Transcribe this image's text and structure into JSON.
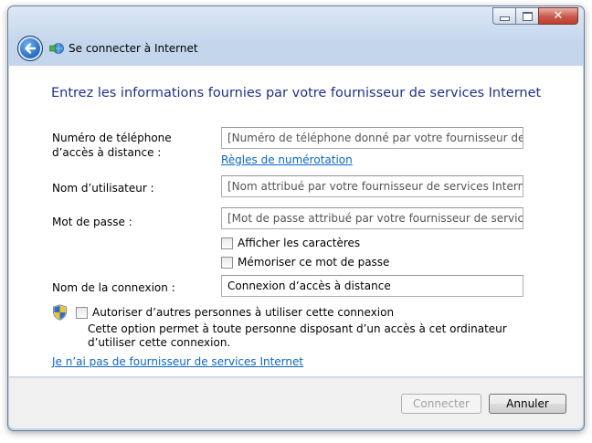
{
  "window": {
    "title": "Se connecter à Internet",
    "controls": {
      "minimize": "minimize-icon",
      "maximize": "maximize-icon",
      "close": "close-icon"
    },
    "back_icon": "back-arrow-icon",
    "title_icon": "network-connection-icon"
  },
  "form": {
    "heading": "Entrez les informations fournies par votre fournisseur de services Internet",
    "phone": {
      "label": "Numéro de téléphone d’accès à distance :",
      "placeholder": "[Numéro de téléphone donné par votre fournisseur de service"
    },
    "dialing_rules_link": "Règles de numérotation",
    "username": {
      "label": "Nom d’utilisateur :",
      "placeholder": "[Nom attribué par votre fournisseur de services Internet]"
    },
    "password": {
      "label": "Mot de passe :",
      "placeholder": "[Mot de passe attribué par votre fournisseur de services Interr"
    },
    "show_chars": {
      "label": "Afficher les caractères",
      "checked": false
    },
    "remember_password": {
      "label": "Mémoriser ce mot de passe",
      "checked": false
    },
    "connection_name": {
      "label": "Nom de la connexion :",
      "value": "Connexion d’accès à distance"
    },
    "allow_others": {
      "label": "Autoriser d’autres personnes à utiliser cette connexion",
      "checked": false,
      "description": "Cette option permet à toute personne disposant d’un accès à cet ordinateur d’utiliser cette connexion.",
      "icon": "uac-shield-icon"
    },
    "no_isp_link": "Je n’ai pas de fournisseur de services Internet"
  },
  "footer": {
    "connect_label": "Connecter",
    "connect_enabled": false,
    "cancel_label": "Annuler"
  },
  "colors": {
    "heading": "#1e3287",
    "link": "#0b66c5"
  }
}
